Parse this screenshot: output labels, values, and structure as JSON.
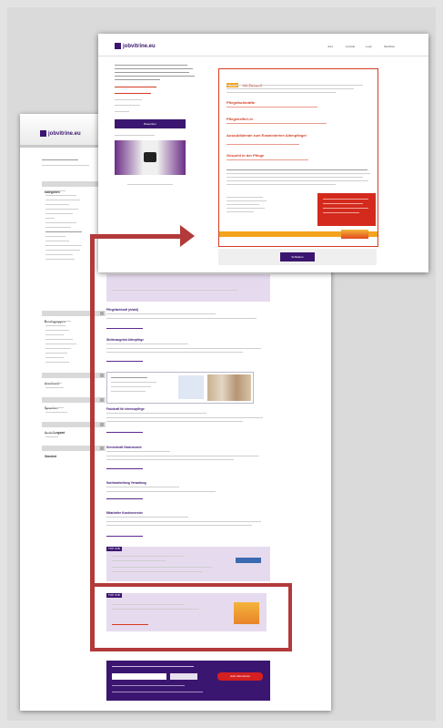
{
  "brand": {
    "logo_text": "jobvitrine.eu",
    "purple": "#3b1670",
    "red": "#b23a3a",
    "popup_red": "#d43c24"
  },
  "front": {
    "nav": [
      "Jobs",
      "Kontakt",
      "Login",
      "Merkliste"
    ],
    "popup_title": "Mit Zukunft",
    "popup_badge": "Jetzt",
    "popup_jobs": [
      "Pflegefachkräfte",
      "Pflegehelfer/-in",
      "Auszubildende zum Examinierten Altenpfleger",
      "Gesucht in der Pflege"
    ],
    "popup_button": "Schließen",
    "left_button": "Bewerben"
  },
  "back": {
    "sidebar_sections": [
      "Kategorien",
      "Berufsgruppen",
      "Arbeitszeit",
      "Sprachen",
      "Anstellungsart",
      "Standort"
    ],
    "job_titles": [
      "Pflegefachkraft (m/w/d)",
      "Stellenangebot Altenpflege",
      "Fachkraft für Intensivpflege",
      "Servicekraft Gastronomie",
      "Sachbearbeitung Verwaltung",
      "Mitarbeiter Kundenservice"
    ],
    "ad_badge": "TOP JOB",
    "highlight_badge": "TOP JOB",
    "footer_button": "Jetzt abonnieren"
  }
}
